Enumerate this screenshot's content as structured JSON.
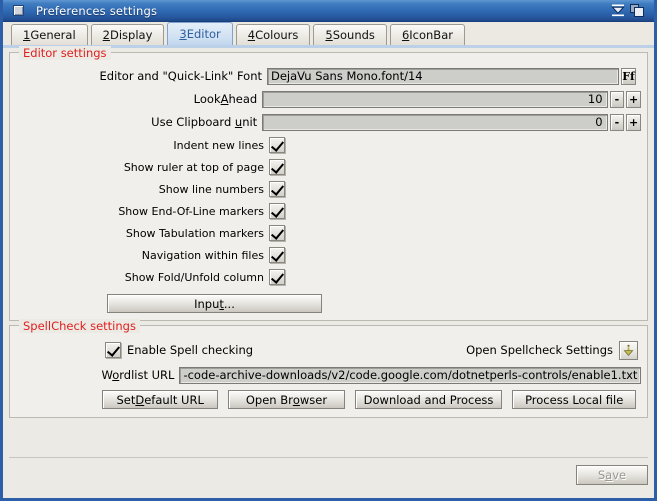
{
  "window": {
    "title": "Preferences settings",
    "menu_box_icon": "window-menu-icon",
    "iconize_icon": "iconize-icon",
    "restore_icon": "restore-window-icon"
  },
  "tabs": [
    {
      "num": "1",
      "label": " General",
      "active": false
    },
    {
      "num": "2",
      "label": " Display",
      "active": false
    },
    {
      "num": "3",
      "label": " Editor",
      "active": true
    },
    {
      "num": "4",
      "label": " Colours",
      "active": false
    },
    {
      "num": "5",
      "label": " Sounds",
      "active": false
    },
    {
      "num": "6",
      "label": " IconBar",
      "active": false
    }
  ],
  "editor_group": {
    "title": "Editor settings",
    "font_row": {
      "label_pre": "Editor and \"Quick-Link\" Font",
      "value": "DejaVu Sans Mono.font/14",
      "button_label": "Ff"
    },
    "lookahead_row": {
      "label_pre": "Look",
      "label_acc": "A",
      "label_post": "head",
      "value": "10",
      "minus": "-",
      "plus": "+"
    },
    "clipboard_row": {
      "label_pre": "Use Clipboard ",
      "label_acc": "u",
      "label_post": "nit",
      "value": "0",
      "minus": "-",
      "plus": "+"
    },
    "checkboxes": [
      {
        "pre": "",
        "acc": "I",
        "post": "ndent new lines",
        "checked": true
      },
      {
        "pre": "Show ",
        "acc": "r",
        "post": "uler at top of page",
        "checked": true
      },
      {
        "pre": "Show ",
        "acc": "l",
        "post": "ine numbers",
        "checked": true
      },
      {
        "pre": "Show E",
        "acc": "n",
        "post": "d-Of-Line markers",
        "checked": true
      },
      {
        "pre": "Show Ta",
        "acc": "b",
        "post": "ulation markers",
        "checked": true
      },
      {
        "pre": "Na",
        "acc": "v",
        "post": "igation within files",
        "checked": true
      },
      {
        "pre": "Show ",
        "acc": "F",
        "post": "old/Unfold column",
        "checked": true
      }
    ],
    "input_button": {
      "pre": "Inpu",
      "acc": "t",
      "post": "..."
    }
  },
  "spellcheck_group": {
    "title": "SpellCheck settings",
    "enable": {
      "pre": "Enable S",
      "acc": "p",
      "post": "ell checking",
      "checked": true
    },
    "open_settings_label": "Open Spellcheck Settings",
    "open_settings_icon": "spellcheck-settings-icon",
    "wordlist": {
      "label_pre": "W",
      "label_acc": "o",
      "label_post": "rdlist URL",
      "value": "-code-archive-downloads/v2/code.google.com/dotnetperls-controls/enable1.txt"
    },
    "buttons": [
      {
        "pre": "Set ",
        "acc": "D",
        "post": "efault URL"
      },
      {
        "pre": "Open Br",
        "acc": "o",
        "post": "wser"
      },
      {
        "pre": "Download and Process",
        "acc": "",
        "post": ""
      },
      {
        "pre": "Process Local file",
        "acc": "",
        "post": ""
      }
    ]
  },
  "footer": {
    "save": {
      "pre": "S",
      "acc": "a",
      "post": "ve",
      "disabled": true
    }
  },
  "colors": {
    "titlebar_blue": "#2f69b3",
    "frame_blue": "#2c5fa8",
    "group_label_red": "#e02020",
    "active_tab_text": "#2e5f9e",
    "window_bg": "#eceae4"
  }
}
